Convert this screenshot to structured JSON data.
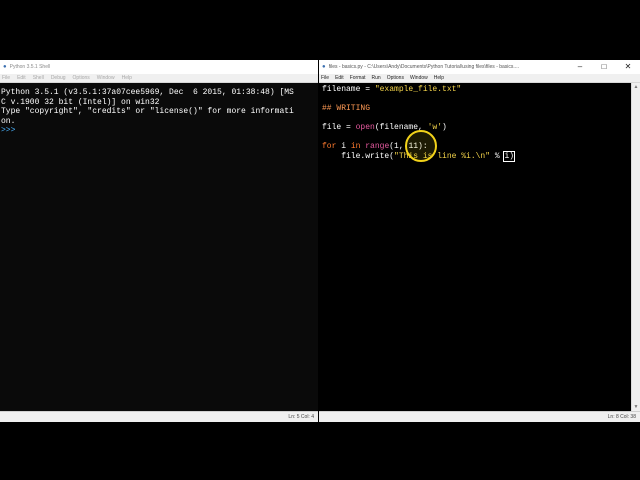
{
  "shell": {
    "title": "Python 3.5.1 Shell",
    "menu": [
      "File",
      "Edit",
      "Shell",
      "Debug",
      "Options",
      "Window",
      "Help"
    ],
    "lines": [
      "Python 3.5.1 (v3.5.1:37a07cee5969, Dec  6 2015, 01:38:48) [MS",
      "C v.1900 32 bit (Intel)] on win32",
      "Type \"copyright\", \"credits\" or \"license()\" for more informati",
      "on."
    ],
    "prompt": ">>> ",
    "status": "Ln: 5   Col: 4"
  },
  "editor": {
    "title": "files - basics.py - C:\\Users\\Andy\\Documents\\Python Tutorial\\using files\\files - basics....",
    "menu": [
      "File",
      "Edit",
      "Format",
      "Run",
      "Options",
      "Window",
      "Help"
    ],
    "status": "Ln: 8   Col: 38",
    "code": {
      "l1_a": "filename = ",
      "l1_b": "\"example_file.txt\"",
      "l3": "## WRITING",
      "l5_a": "file = ",
      "l5_b": "open",
      "l5_c": "(filename, ",
      "l5_d": "'w'",
      "l5_e": ")",
      "l7_a": "for",
      "l7_b": " i ",
      "l7_c": "in",
      "l7_d": " ",
      "l7_e": "range",
      "l7_f": "(1, 11):",
      "l8_a": "    file.write(",
      "l8_b": "\"This is line %i.\\n\"",
      "l8_c": " % ",
      "l8_d": "i)"
    }
  },
  "window_controls": {
    "minimize": "–",
    "maximize": "□",
    "close": "✕"
  }
}
